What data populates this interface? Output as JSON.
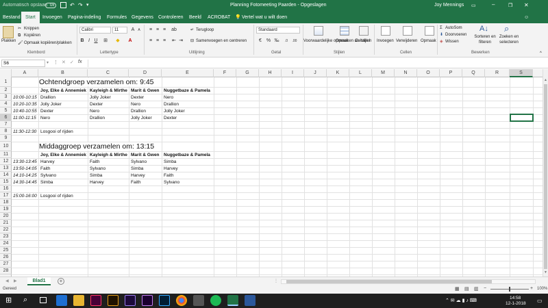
{
  "titlebar": {
    "autosave_label": "Automatisch opslaan",
    "autosave_state": "Uit",
    "title": "Planning Fotomeeting Paarden  -  Opgeslagen",
    "user": "Joy Mennings"
  },
  "tabs": [
    "Bestand",
    "Start",
    "Invoegen",
    "Pagina-indeling",
    "Formules",
    "Gegevens",
    "Controleren",
    "Beeld",
    "ACROBAT"
  ],
  "tell_me": "Vertel wat u wilt doen",
  "ribbon": {
    "clipboard": {
      "paste": "Plakken",
      "cut": "Knippen",
      "copy": "Kopiëren",
      "format_painter": "Opmaak kopiëren/plakken",
      "group": "Klembord"
    },
    "font": {
      "name": "Calibri",
      "size": "11",
      "group": "Lettertype"
    },
    "alignment": {
      "wrap": "Terugloop",
      "merge": "Samenvoegen en centreren",
      "group": "Uitlijning"
    },
    "number": {
      "format": "Standaard",
      "group": "Getal"
    },
    "styles": {
      "conditional": "Voorwaardelijke opmaak",
      "as_table": "Opmaken als tabel",
      "cell_styles": "Celstijlen",
      "group": "Stijlen"
    },
    "cells": {
      "insert": "Invoegen",
      "delete": "Verwijderen",
      "format": "Opmaak",
      "group": "Cellen"
    },
    "editing": {
      "autosum": "AutoSom",
      "fill": "Doorvoeren",
      "clear": "Wissen",
      "sort": "Sorteren en filteren",
      "find": "Zoeken en selecteren",
      "group": "Bewerken"
    }
  },
  "namebox": "S6",
  "fx": "fx",
  "columns": [
    "A",
    "B",
    "C",
    "D",
    "E",
    "F",
    "G",
    "H",
    "I",
    "J",
    "K",
    "L",
    "M",
    "N",
    "O",
    "P",
    "Q",
    "R",
    "S"
  ],
  "rows": [
    "1",
    "2",
    "3",
    "4",
    "5",
    "6",
    "7",
    "8",
    "9",
    "10",
    "11",
    "12",
    "13",
    "14",
    "15",
    "16",
    "17",
    "18",
    "19",
    "20",
    "21",
    "22",
    "23",
    "24",
    "25",
    "26",
    "27",
    "28"
  ],
  "sheet": {
    "morning_heading": "Ochtendgroep verzamelen om: 9:45",
    "afternoon_heading": "Middaggroep verzamelen om: 13:15",
    "headers": [
      "Joy, Elke & Annemiek",
      "Kayleigh & Mirthe",
      "Marit & Gwen",
      "Nuggetbaze & Pamela"
    ],
    "morning": [
      {
        "time": "10:00-10:15",
        "cells": [
          "Drallion",
          "Jolly Joker",
          "Dexter",
          "Nero"
        ]
      },
      {
        "time": "10:20-10:35",
        "cells": [
          "Jolly Joker",
          "Dexter",
          "Nero",
          "Drallion"
        ]
      },
      {
        "time": "10:40-10:55",
        "cells": [
          "Dexter",
          "Nero",
          "Drallion",
          "Jolly Joker"
        ]
      },
      {
        "time": "11:00-11:15",
        "cells": [
          "Nero",
          "Drallion",
          "Jolly Joker",
          "Dexter"
        ]
      }
    ],
    "morning_end": {
      "time": "11:30-12:30",
      "text": "Losgooi of rijden"
    },
    "afternoon": [
      {
        "time": "13:30-13:45",
        "cells": [
          "Harvey",
          "Faith",
          "Sylvano",
          "Simba"
        ]
      },
      {
        "time": "13:50-14:05",
        "cells": [
          "Faith",
          "Sylvano",
          "Simba",
          "Harvey"
        ]
      },
      {
        "time": "14:10-14:25",
        "cells": [
          "Sylvano",
          "Simba",
          "Harvey",
          "Faith"
        ]
      },
      {
        "time": "14:30-14:45",
        "cells": [
          "Simba",
          "Harvey",
          "Faith",
          "Sylvano"
        ]
      }
    ],
    "afternoon_end": {
      "time": "15:00-16:00",
      "text": "Losgooi of rijden"
    }
  },
  "sheet_tab": "Blad1",
  "status": {
    "ready": "Gereed",
    "zoom": "100%"
  },
  "taskbar": {
    "time": "14:58",
    "date": "12-1-2018"
  },
  "colors": {
    "excel_green": "#217346",
    "taskbar": "#1f1f1f"
  }
}
